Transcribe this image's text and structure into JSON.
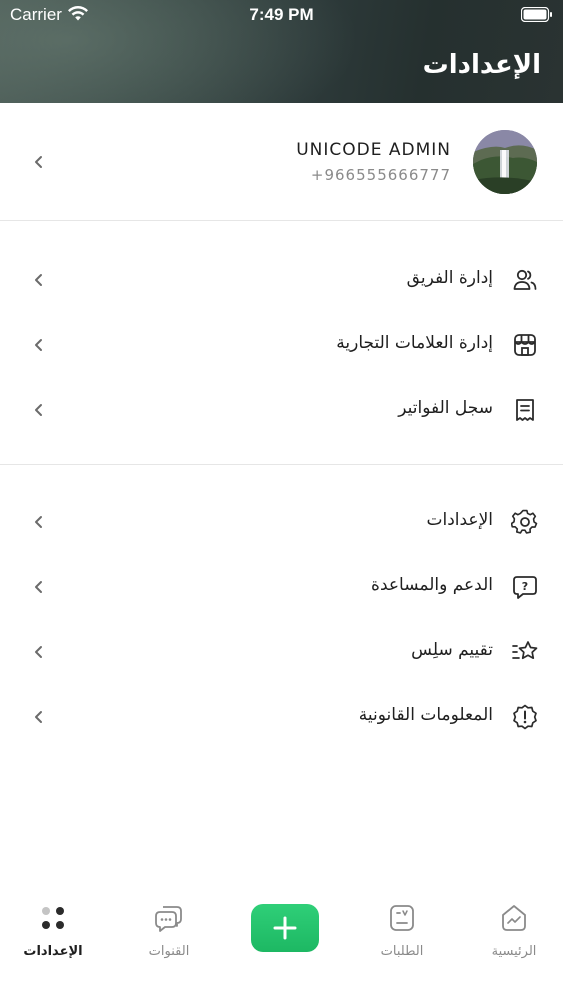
{
  "status_bar": {
    "carrier": "Carrier",
    "time": "7:49 PM"
  },
  "header": {
    "title": "الإعدادات"
  },
  "profile": {
    "name": "UNICODE ADMIN",
    "phone": "+966555666777"
  },
  "menu_groups": [
    {
      "items": [
        {
          "label": "إدارة الفريق",
          "icon": "team-users-icon"
        },
        {
          "label": "إدارة العلامات التجارية",
          "icon": "storefront-icon"
        },
        {
          "label": "سجل الفواتير",
          "icon": "receipt-icon"
        }
      ]
    },
    {
      "items": [
        {
          "label": "الإعدادات",
          "icon": "gear-icon"
        },
        {
          "label": "الدعم والمساعدة",
          "icon": "help-chat-icon"
        },
        {
          "label": "تقييم سلِس",
          "icon": "star-rating-icon"
        },
        {
          "label": "المعلومات القانونية",
          "icon": "info-badge-icon"
        }
      ]
    }
  ],
  "tabbar": {
    "home": "الرئيسية",
    "orders": "الطلبات",
    "channels": "القنوات",
    "settings": "الإعدادات",
    "active": "settings"
  },
  "colors": {
    "accent": "#22c06b",
    "header_dark": "#2d3a3a"
  }
}
